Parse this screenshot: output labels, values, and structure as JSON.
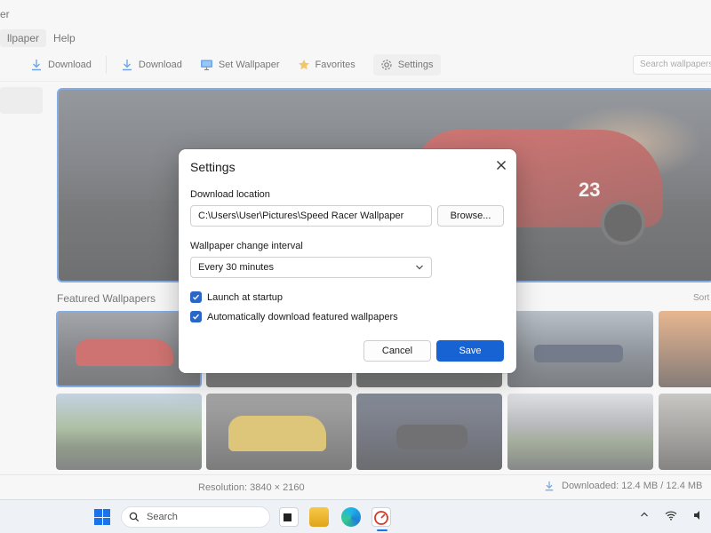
{
  "window": {
    "title_fragment": "er"
  },
  "menu": [
    {
      "label": "llpaper",
      "active": true
    },
    {
      "label": "Help",
      "active": false
    }
  ],
  "toolbar": {
    "download1": "Download",
    "download2": "Download",
    "set_wallpaper": "Set Wallpaper",
    "favorites": "Favorites",
    "settings": "Settings",
    "search_placeholder": "Search wallpapers..."
  },
  "main": {
    "featured_title": "Featured Wallpapers",
    "sort_label": "Sort"
  },
  "statusbar": {
    "resolution": "Resolution: 3840 × 2160",
    "downloaded": "Downloaded: 12.4 MB / 12.4 MB"
  },
  "dialog": {
    "title": "Settings",
    "download_location_label": "Download location",
    "download_path": "C:\\Users\\User\\Pictures\\Speed Racer Wallpaper",
    "browse_label": "Browse...",
    "interval_label": "Wallpaper change interval",
    "interval_value": "Every 30 minutes",
    "launch_at_startup_label": "Launch at startup",
    "launch_at_startup_checked": true,
    "auto_download_label": "Automatically download featured wallpapers",
    "auto_download_checked": true,
    "cancel_label": "Cancel",
    "save_label": "Save"
  },
  "taskbar": {
    "search_label": "Search"
  },
  "colors": {
    "accent": "#1863d4",
    "checkbox": "#2866c8",
    "selection_border": "#3a7bd5"
  }
}
